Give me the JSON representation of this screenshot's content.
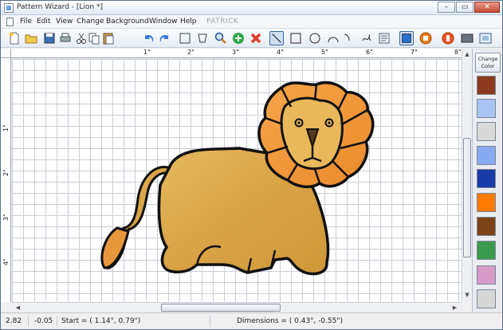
{
  "window": {
    "title": "Pattern Wizard - [Lion *]",
    "controls": {
      "minimize": "–",
      "restore": "▭",
      "close": "✕"
    }
  },
  "menu": {
    "items": [
      "File",
      "Edit",
      "View",
      "Change",
      "Background",
      "Window",
      "Help"
    ],
    "user": "PATRICK"
  },
  "toolbar": {
    "buttons": [
      "new-document-icon",
      "open-folder-icon",
      "save-icon",
      "print-icon",
      "cut-icon",
      "copy-icon",
      "paste-icon",
      "undo-icon",
      "redo-icon",
      "select-rectangle-icon",
      "lasso-icon",
      "zoom-icon",
      "add-green-icon",
      "delete-red-icon",
      "line-tool-icon",
      "rectangle-tool-icon",
      "ellipse-tool-icon",
      "arc-tool-icon",
      "curve-tool-icon",
      "freehand-tool-icon",
      "properties-icon",
      "fill-color-icon",
      "stop-orange-icon",
      "glass-orange-icon",
      "screen-icon",
      "fit-view-icon"
    ]
  },
  "ruler": {
    "top_labels": [
      "1\"",
      "2\"",
      "3\"",
      "4\"",
      "5\"",
      "6\"",
      "7\"",
      "8\""
    ],
    "left_labels": [
      "1\"",
      "2\"",
      "3\"",
      "4\""
    ]
  },
  "palette": {
    "change_color_label": "Change Color",
    "swatches": [
      "#8b3a20",
      "#a9c4f2",
      "#d9d9d9",
      "#88aaf0",
      "#1a3aa8",
      "#ff7a00",
      "#7a4418",
      "#3c9a4e",
      "#d59ac8",
      "#d7d7d7"
    ]
  },
  "status": {
    "x": "2.82",
    "y": "-0.05",
    "start": "Start = ( 1.14\",  0.79\")",
    "dimensions": "Dimensions = ( 0.43\", -0.55\")"
  },
  "colors": {
    "lion_body": "#dba94a",
    "lion_mane": "#f0953a",
    "lion_face": "#e9b85a",
    "outline": "#111111"
  }
}
